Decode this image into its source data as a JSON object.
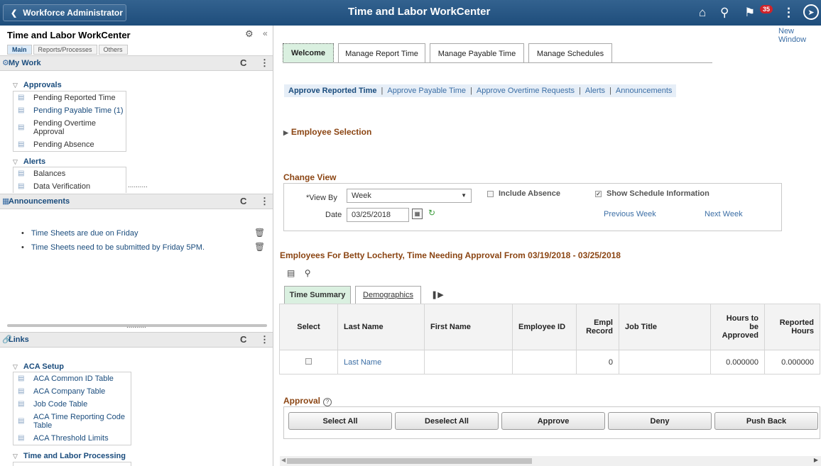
{
  "banner": {
    "back_label": "Workforce Administrator",
    "title": "Time and Labor WorkCenter",
    "notification_count": "35"
  },
  "left_panel": {
    "title": "Time and Labor WorkCenter",
    "tabs": [
      "Main",
      "Reports/Processes",
      "Others"
    ],
    "my_work": {
      "title": "My Work",
      "approvals_label": "Approvals",
      "approvals": [
        "Pending Reported Time",
        "Pending Payable Time (1)",
        "Pending Overtime Approval",
        "Pending Absence"
      ],
      "alerts_label": "Alerts",
      "alerts": [
        "Balances",
        "Data Verification"
      ]
    },
    "announcements": {
      "title": "Announcements",
      "items": [
        "Time Sheets are due on Friday",
        "Time Sheets need to be submitted by Friday 5PM."
      ]
    },
    "links": {
      "title": "Links",
      "aca_label": "ACA Setup",
      "aca_items": [
        "ACA Common ID Table",
        "ACA Company Table",
        "Job Code Table",
        "ACA Time Reporting Code Table",
        "ACA Threshold Limits"
      ],
      "processing_label": "Time and Labor Processing"
    }
  },
  "main": {
    "new_window": "New Window",
    "tabs": [
      "Welcome",
      "Manage Report Time",
      "Manage Payable Time",
      "Manage Schedules"
    ],
    "subnav": [
      "Approve Reported Time",
      "Approve Payable Time",
      "Approve Overtime Requests",
      "Alerts",
      "Announcements"
    ],
    "employee_selection": "Employee Selection",
    "change_view": {
      "title": "Change View",
      "view_by_label": "*View By",
      "view_by_value": "Week",
      "date_label": "Date",
      "date_value": "03/25/2018",
      "include_absence": "Include Absence",
      "show_schedule": "Show Schedule Information",
      "previous_week": "Previous Week",
      "next_week": "Next Week"
    },
    "grid_title": "Employees For Betty Locherty, Time Needing Approval From 03/19/2018 - 03/25/2018",
    "grid_tabs": [
      "Time Summary",
      "Demographics"
    ],
    "columns": [
      "Select",
      "Last Name",
      "First Name",
      "Employee ID",
      "Empl Record",
      "Job Title",
      "Hours to be Approved",
      "Reported Hours"
    ],
    "rows": [
      {
        "last_name": "Last Name",
        "first_name": "",
        "employee_id": "",
        "empl_record": "0",
        "job_title": "",
        "hours_to_approve": "0.000000",
        "reported_hours": "0.000000"
      }
    ],
    "approval": {
      "title": "Approval",
      "buttons": [
        "Select All",
        "Deselect All",
        "Approve",
        "Deny",
        "Push Back"
      ]
    }
  }
}
